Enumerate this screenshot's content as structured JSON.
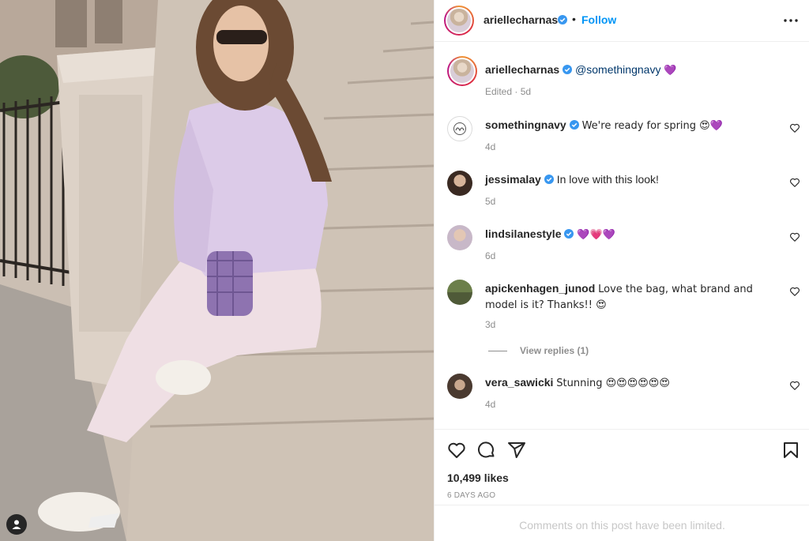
{
  "post": {
    "image_alt": "Woman in lavender shirt sitting on stone steps holding a purple bag",
    "author": "ariellecharnas",
    "follow_label": "Follow",
    "separator": "•"
  },
  "caption": {
    "username": "ariellecharnas",
    "mention": "@somethingnavy",
    "emoji": "💜",
    "meta": "Edited · 5d"
  },
  "comments": [
    {
      "username": "somethingnavy",
      "text": "We're ready for spring 😍💜",
      "age": "4d"
    },
    {
      "username": "jessimalay",
      "text": "In love with this look!",
      "age": "5d"
    },
    {
      "username": "lindsilanestyle",
      "text": "💜💗💜",
      "age": "6d"
    },
    {
      "username": "apickenhagen_junod",
      "text": "Love the bag, what brand and model is it? Thanks!! 😍",
      "age": "3d"
    },
    {
      "username": "vera_sawicki",
      "text": "Stunning 😍😍😍😍😍😍",
      "age": "4d"
    }
  ],
  "view_replies": "View replies (1)",
  "likes": "10,499 likes",
  "posted_time": "6 DAYS AGO",
  "comments_limited": "Comments on this post have been limited.",
  "icons": {
    "verified": "verified-badge-icon",
    "more": "more-options-icon",
    "like": "heart-icon",
    "comment": "comment-icon",
    "share": "share-icon",
    "save": "bookmark-icon",
    "tags": "user-tags-icon"
  },
  "colors": {
    "accent": "#0095f6",
    "text": "#262626",
    "muted": "#8e8e8e",
    "border": "#efefef",
    "verified": "#3897f0"
  }
}
